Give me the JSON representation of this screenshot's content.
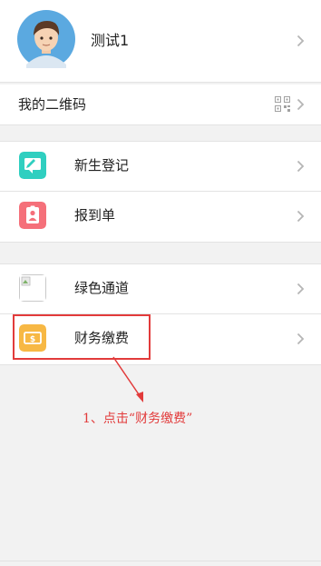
{
  "profile": {
    "username": "测试1"
  },
  "qr": {
    "label": "我的二维码"
  },
  "menu_group_1": [
    {
      "label": "新生登记",
      "icon": "edit-icon",
      "color": "#2fcfc0"
    },
    {
      "label": "报到单",
      "icon": "id-badge-icon",
      "color": "#f5707a"
    }
  ],
  "menu_group_2": [
    {
      "label": "绿色通道",
      "icon": "broken-image-icon",
      "color": "#ffffff"
    },
    {
      "label": "财务缴费",
      "icon": "money-icon",
      "color": "#f7b844"
    }
  ],
  "annotation": {
    "text": "1、点击“财务缴费”",
    "color": "#e23b3b"
  }
}
